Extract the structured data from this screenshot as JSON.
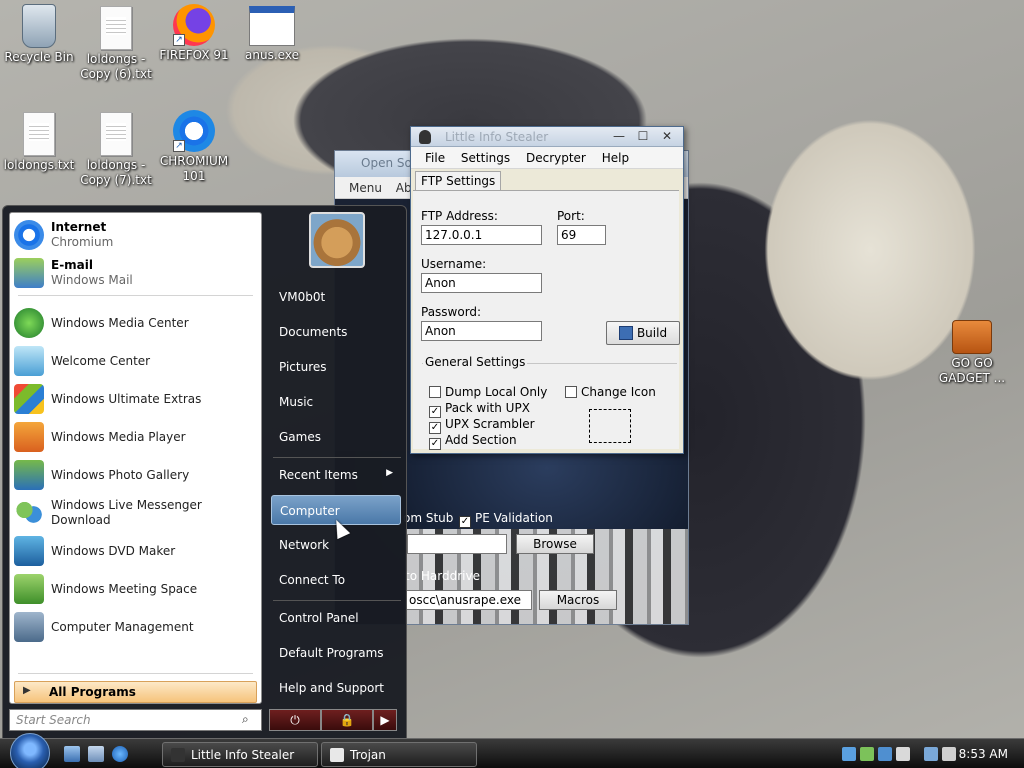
{
  "desktop_icons": [
    {
      "label": "Recycle Bin",
      "icon": "recycle-bin-icon"
    },
    {
      "label": "loldongs - Copy (6).txt",
      "icon": "text-file-icon"
    },
    {
      "label": "FIREFOX 91",
      "icon": "firefox-icon"
    },
    {
      "label": "anus.exe",
      "icon": "exe-window-icon"
    },
    {
      "label": "loldongs.txt",
      "icon": "text-file-icon"
    },
    {
      "label": "loldongs - Copy (7).txt",
      "icon": "text-file-icon"
    },
    {
      "label": "CHROMIUM 101",
      "icon": "chromium-icon"
    },
    {
      "label": "GO GO GADGET ...",
      "icon": "briefcase-icon"
    }
  ],
  "bg_window": {
    "title": "Open So",
    "menu": [
      "Menu",
      "Abo"
    ],
    "stub_label": "om Stub",
    "pe_validation": "PE Validation",
    "browse": "Browse",
    "harddrive_label": "to Harddrive",
    "path_value": "oscc\\anusrape.exe",
    "macros": "Macros"
  },
  "app": {
    "title": "Little Info Stealer",
    "menu": [
      "File",
      "Settings",
      "Decrypter",
      "Help"
    ],
    "tab": "FTP Settings",
    "ftp_address_label": "FTP Address:",
    "ftp_address_value": "127.0.0.1",
    "port_label": "Port:",
    "port_value": "69",
    "username_label": "Username:",
    "username_value": "Anon",
    "password_label": "Password:",
    "password_value": "Anon",
    "build_label": "Build",
    "general_settings": "General Settings",
    "options": [
      {
        "label": "Dump Local Only",
        "checked": false
      },
      {
        "label": "Pack with UPX",
        "checked": true
      },
      {
        "label": "UPX Scrambler",
        "checked": true
      },
      {
        "label": "Add Section",
        "checked": true
      }
    ],
    "change_icon": {
      "label": "Change Icon",
      "checked": false
    }
  },
  "start_menu": {
    "pinned": [
      {
        "title": "Internet",
        "subtitle": "Chromium"
      },
      {
        "title": "E-mail",
        "subtitle": "Windows Mail"
      }
    ],
    "programs": [
      "Windows Media Center",
      "Welcome Center",
      "Windows Ultimate Extras",
      "Windows Media Player",
      "Windows Photo Gallery",
      "Windows Live Messenger Download",
      "Windows DVD Maker",
      "Windows Meeting Space",
      "Computer Management"
    ],
    "all_programs": "All Programs",
    "search_placeholder": "Start Search",
    "right_items": [
      "VM0b0t",
      "Documents",
      "Pictures",
      "Music",
      "Games",
      "Recent Items",
      "Computer",
      "Network",
      "Connect To",
      "Control Panel",
      "Default Programs",
      "Help and Support"
    ]
  },
  "taskbar": {
    "buttons": [
      "Little Info Stealer",
      "Trojan"
    ],
    "clock": "8:53 AM"
  }
}
